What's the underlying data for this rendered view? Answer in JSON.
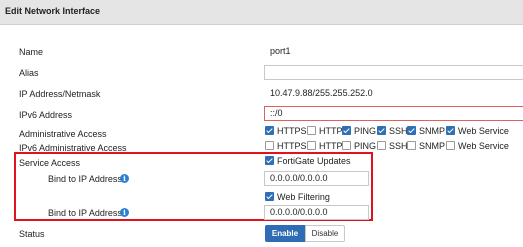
{
  "header": {
    "title": "Edit Network Interface"
  },
  "fields": {
    "name": {
      "label": "Name",
      "value": "port1"
    },
    "alias": {
      "label": "Alias",
      "value": ""
    },
    "ip": {
      "label": "IP Address/Netmask",
      "value": "10.47.9.88/255.255.252.0"
    },
    "ipv6": {
      "label": "IPv6 Address",
      "value": "::/0"
    }
  },
  "admin_access": {
    "label": "Administrative Access",
    "options": [
      {
        "label": "HTTPS",
        "checked": true
      },
      {
        "label": "HTTP",
        "checked": false
      },
      {
        "label": "PING",
        "checked": true
      },
      {
        "label": "SSH",
        "checked": true
      },
      {
        "label": "SNMP",
        "checked": true
      },
      {
        "label": "Web Service",
        "checked": true
      }
    ]
  },
  "ipv6_admin_access": {
    "label": "IPv6 Administrative Access",
    "options": [
      {
        "label": "HTTPS",
        "checked": false
      },
      {
        "label": "HTTP",
        "checked": false
      },
      {
        "label": "PING",
        "checked": false
      },
      {
        "label": "SSH",
        "checked": false
      },
      {
        "label": "SNMP",
        "checked": false
      },
      {
        "label": "Web Service",
        "checked": false
      }
    ]
  },
  "service_access": {
    "label": "Service Access",
    "fortigate_updates": {
      "label": "FortiGate Updates",
      "checked": true
    },
    "bind1": {
      "label": "Bind to IP Address",
      "value": "0.0.0.0/0.0.0.0"
    },
    "web_filtering": {
      "label": "Web Filtering",
      "checked": true
    },
    "bind2": {
      "label": "Bind to IP Address",
      "value": "0.0.0.0/0.0.0.0"
    }
  },
  "status": {
    "label": "Status",
    "enable": "Enable",
    "disable": "Disable",
    "selected": "Enable"
  },
  "colors": {
    "accent": "#2e6db4",
    "highlight": "#e0121e",
    "error_border": "#e06060",
    "info": "#2f7fd0"
  },
  "icons": {
    "info": "info-icon"
  }
}
